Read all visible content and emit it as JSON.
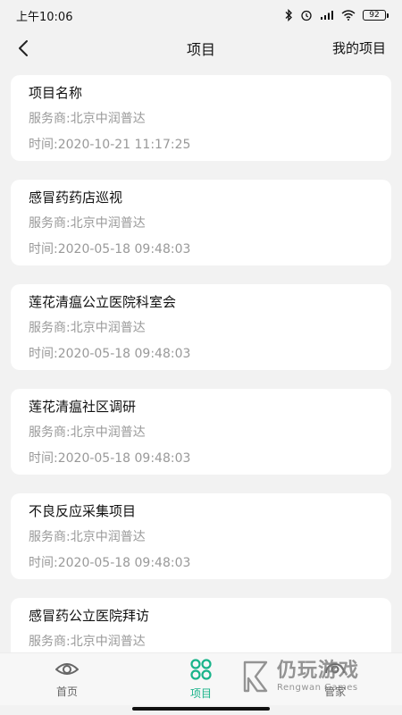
{
  "status_bar": {
    "time": "上午10:06",
    "battery": "92"
  },
  "header": {
    "title": "项目",
    "right_link": "我的项目"
  },
  "projects": [
    {
      "name": "项目名称",
      "provider": "服务商:北京中润普达",
      "time": "时间:2020-10-21 11:17:25"
    },
    {
      "name": "感冒药药店巡视",
      "provider": "服务商:北京中润普达",
      "time": "时间:2020-05-18 09:48:03"
    },
    {
      "name": "莲花清瘟公立医院科室会",
      "provider": "服务商:北京中润普达",
      "time": "时间:2020-05-18 09:48:03"
    },
    {
      "name": "莲花清瘟社区调研",
      "provider": "服务商:北京中润普达",
      "time": "时间:2020-05-18 09:48:03"
    },
    {
      "name": "不良反应采集项目",
      "provider": "服务商:北京中润普达",
      "time": "时间:2020-05-18 09:48:03"
    },
    {
      "name": "感冒药公立医院拜访",
      "provider": "服务商:北京中润普达",
      "time": ""
    }
  ],
  "tabs": [
    {
      "label": "首页",
      "icon": "eye-icon",
      "active": false
    },
    {
      "label": "项目",
      "icon": "grid-circles-icon",
      "active": true
    },
    {
      "label": "管家",
      "icon": "steward-icon",
      "active": false
    }
  ],
  "watermark": {
    "cn": "仍玩游戏",
    "en": "Rengwan Games"
  },
  "colors": {
    "accent": "#19b38a",
    "background": "#f2f2f2",
    "card": "#ffffff",
    "muted_text": "#999999"
  }
}
